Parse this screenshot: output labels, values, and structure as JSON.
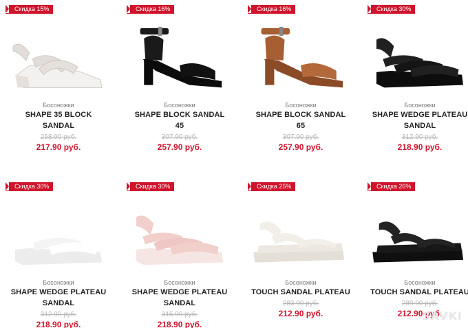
{
  "products": [
    {
      "badge": "Скидка 15%",
      "category": "Босоножки",
      "name": "SHAPE 35 BLOCK SANDAL",
      "old_price": "258.90 руб.",
      "new_price": "217.90 руб.",
      "colors": {
        "main": "#e6e0dc",
        "strap": "#e2ddd8",
        "sole": "#f3f1ef"
      }
    },
    {
      "badge": "Скидка 16%",
      "category": "Босоножки",
      "name": "SHAPE BLOCK SANDAL 45",
      "old_price": "307.90 руб.",
      "new_price": "257.90 руб.",
      "colors": {
        "main": "#111111",
        "strap": "#1a1a1a",
        "sole": "#0c0c0c"
      }
    },
    {
      "badge": "Скидка 16%",
      "category": "Босоножки",
      "name": "SHAPE BLOCK SANDAL 65",
      "old_price": "307.90 руб.",
      "new_price": "257.90 руб.",
      "colors": {
        "main": "#b3693a",
        "strap": "#a75e33",
        "sole": "#8b4b27"
      }
    },
    {
      "badge": "Скидка 30%",
      "category": "Босоножки",
      "name": "SHAPE WEDGE PLATEAU SANDAL",
      "old_price": "312.90 руб.",
      "new_price": "218.90 руб.",
      "colors": {
        "main": "#151515",
        "strap": "#202020",
        "sole": "#0d0d0d"
      }
    },
    {
      "badge": "Скидка 30%",
      "category": "Босоножки",
      "name": "SHAPE WEDGE PLATEAU SANDAL",
      "old_price": "312.90 руб.",
      "new_price": "218.90 руб.",
      "colors": {
        "main": "#f4f4f4",
        "strap": "#ffffff",
        "sole": "#ececec"
      }
    },
    {
      "badge": "Скидка 30%",
      "category": "Босоножки",
      "name": "SHAPE WEDGE PLATEAU SANDAL",
      "old_price": "315.90 руб.",
      "new_price": "218.90 руб.",
      "colors": {
        "main": "#efc7c4",
        "strap": "#f1cfcb",
        "sole": "#f6e6e3"
      }
    },
    {
      "badge": "Скидка 25%",
      "category": "Босоножки",
      "name": "TOUCH SANDAL PLATEAU",
      "old_price": "283.90 руб.",
      "new_price": "212.90 руб.",
      "colors": {
        "main": "#ece8e1",
        "strap": "#f2efe9",
        "sole": "#e4e0d8"
      }
    },
    {
      "badge": "Скидка 26%",
      "category": "Босоножки",
      "name": "TOUCH SANDAL PLATEAU",
      "old_price": "289.90 руб.",
      "new_price": "212.90 руб.",
      "colors": {
        "main": "#181818",
        "strap": "#232323",
        "sole": "#0f0f0f"
      }
    }
  ],
  "watermark": "SAVKI"
}
